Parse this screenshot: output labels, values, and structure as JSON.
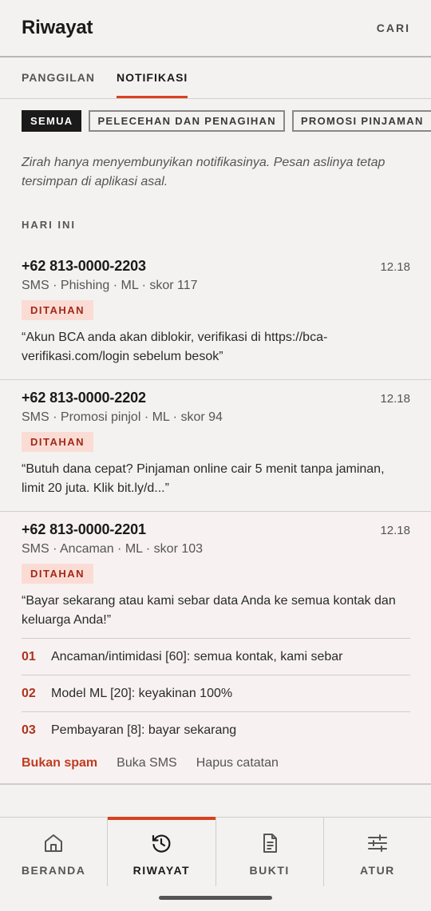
{
  "header": {
    "title": "Riwayat",
    "search_label": "CARI"
  },
  "tabs": [
    {
      "label": "PANGGILAN",
      "active": false
    },
    {
      "label": "NOTIFIKASI",
      "active": true
    }
  ],
  "filters": [
    {
      "label": "SEMUA",
      "active": true
    },
    {
      "label": "PELECEHAN DAN PENAGIHAN",
      "active": false
    },
    {
      "label": "PROMOSI PINJAMAN",
      "active": false
    }
  ],
  "info_text": "Zirah hanya menyembunyikan notifikasinya. Pesan aslinya tetap tersimpan di aplikasi asal.",
  "section_label": "HARI INI",
  "items": [
    {
      "phone": "+62 813-0000-2203",
      "time": "12.18",
      "meta": "SMS · Phishing · ML · skor 117",
      "badge": "DITAHAN",
      "message": "“Akun BCA anda akan diblokir, verifikasi di https://bca-verifikasi.com/login sebelum besok”"
    },
    {
      "phone": "+62 813-0000-2202",
      "time": "12.18",
      "meta": "SMS · Promosi pinjol · ML · skor 94",
      "badge": "DITAHAN",
      "message": "“Butuh dana cepat? Pinjaman online cair 5 menit tanpa jaminan, limit 20 juta. Klik bit.ly/d...”"
    },
    {
      "phone": "+62 813-0000-2201",
      "time": "12.18",
      "meta": "SMS · Ancaman · ML · skor 103",
      "badge": "DITAHAN",
      "message": "“Bayar sekarang atau kami sebar data Anda ke semua kontak dan keluarga Anda!”",
      "reasons": [
        {
          "num": "01",
          "text": "Ancaman/intimidasi [60]: semua kontak, kami sebar"
        },
        {
          "num": "02",
          "text": "Model ML [20]: keyakinan 100%"
        },
        {
          "num": "03",
          "text": "Pembayaran [8]: bayar sekarang"
        }
      ],
      "actions": {
        "not_spam": "Bukan spam",
        "open_sms": "Buka SMS",
        "delete": "Hapus catatan"
      }
    }
  ],
  "nav": [
    {
      "label": "BERANDA",
      "icon": "home-icon",
      "active": false
    },
    {
      "label": "RIWAYAT",
      "icon": "history-icon",
      "active": true
    },
    {
      "label": "BUKTI",
      "icon": "document-icon",
      "active": false
    },
    {
      "label": "ATUR",
      "icon": "sliders-icon",
      "active": false
    }
  ],
  "colors": {
    "accent": "#d8411f",
    "badge_bg": "#fbdcd5",
    "badge_text": "#a12a18"
  }
}
